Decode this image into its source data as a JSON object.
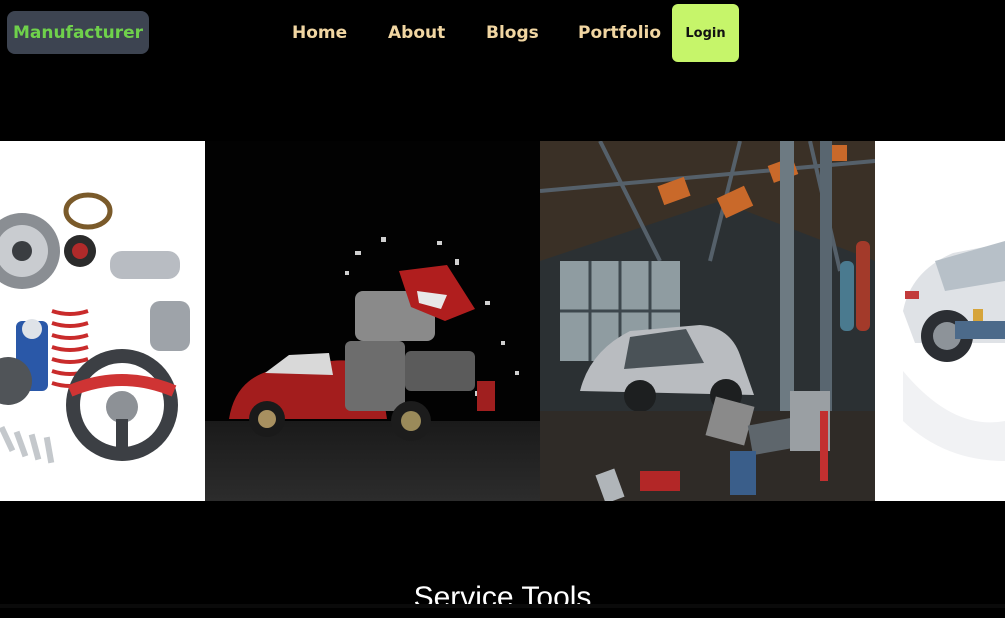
{
  "navbar": {
    "brand": "Manufacturer",
    "links": [
      "Home",
      "About",
      "Blogs",
      "Portfolio"
    ],
    "login_label": "Login"
  },
  "carousel": {
    "slides": [
      {
        "subject": "auto-parts-assortment"
      },
      {
        "subject": "exploded-red-sports-car"
      },
      {
        "subject": "garage-workshop-with-car"
      },
      {
        "subject": "white-car-cutaway"
      }
    ]
  },
  "section": {
    "title": "Service Tools"
  },
  "colors": {
    "background": "#000000",
    "brand_bg": "#3d4451",
    "brand_text": "#6fd14b",
    "nav_text": "#f1d6a2",
    "login_bg": "#c6f56a"
  }
}
